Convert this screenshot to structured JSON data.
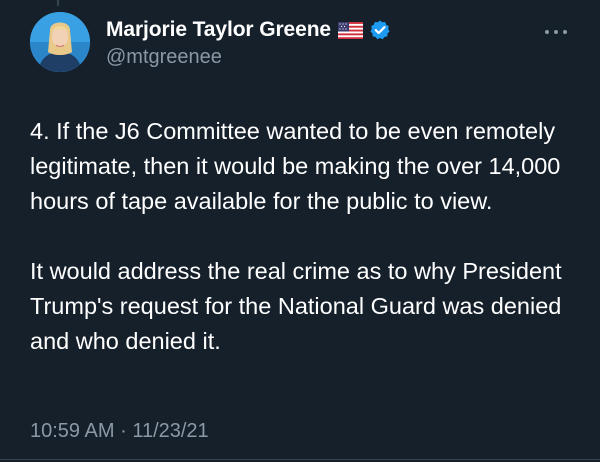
{
  "author": {
    "display_name": "Marjorie Taylor Greene",
    "handle": "@mtgreenee",
    "flag_icon": "us-flag-icon",
    "verified_icon": "verified-badge-icon",
    "verified_color": "#1d9bf0"
  },
  "tweet": {
    "paragraphs": [
      "4. If the J6 Committee wanted to be even remotely legitimate, then it would be making the over 14,000 hours of tape available for the public to view.",
      "It would address the real crime as to why President Trump's request for the National Guard was denied and who denied it."
    ],
    "time": "10:59 AM",
    "separator": "·",
    "date": "11/23/21"
  },
  "menu": {
    "more_icon": "more-options-icon"
  },
  "colors": {
    "background": "#15202b",
    "primary_text": "#ffffff",
    "secondary_text": "#8b98a5"
  }
}
